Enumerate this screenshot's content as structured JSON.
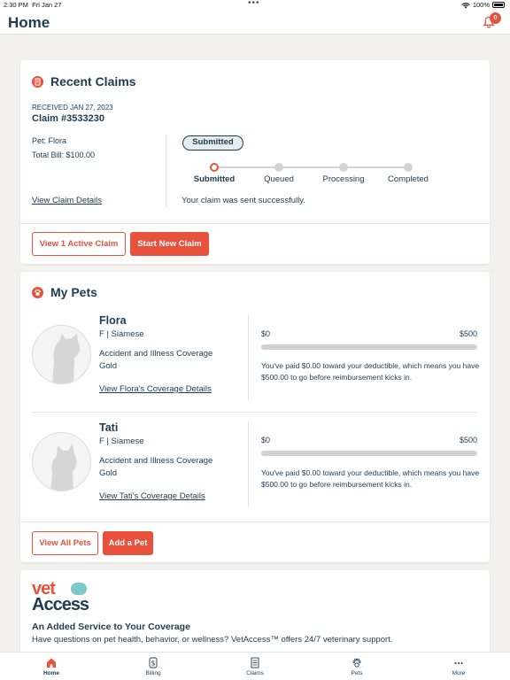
{
  "status": {
    "time": "2:30 PM",
    "date": "Fri Jan 27",
    "battery": "100%"
  },
  "header": {
    "title": "Home",
    "notification_count": "0"
  },
  "recent_claims": {
    "title": "Recent Claims",
    "received": "RECEIVED JAN 27, 2023",
    "claim_number": "Claim #3533230",
    "pet": "Pet: Flora",
    "total_bill": "Total Bill: $100.00",
    "view_details": "View Claim Details",
    "status_badge": "Submitted",
    "steps": [
      "Submitted",
      "Queued",
      "Processing",
      "Completed"
    ],
    "active_step": 0,
    "message": "Your claim was sent successfully.",
    "btn_active": "View 1 Active Claim",
    "btn_new": "Start New Claim"
  },
  "my_pets": {
    "title": "My Pets",
    "pets": [
      {
        "name": "Flora",
        "info": "F | Siamese",
        "coverage": "Accident and Illness Coverage",
        "plan": "Gold",
        "link": "View Flora's Coverage Details",
        "min": "$0",
        "max": "$500",
        "deductible_paid_fraction": 0,
        "desc": "You've paid $0.00 toward your deductible, which means you have $500.00 to go before reimbursement kicks in."
      },
      {
        "name": "Tati",
        "info": "F | Siamese",
        "coverage": "Accident and Illness Coverage",
        "plan": "Gold",
        "link": "View Tati's Coverage Details",
        "min": "$0",
        "max": "$500",
        "deductible_paid_fraction": 0,
        "desc": "You've paid $0.00 toward your deductible, which means you have $500.00 to go before reimbursement kicks in."
      }
    ],
    "btn_all": "View All Pets",
    "btn_add": "Add a Pet"
  },
  "vetaccess": {
    "logo_top": "vet",
    "logo_bottom": "Access",
    "heading": "An Added Service to Your Coverage",
    "text": "Have questions on pet health, behavior, or wellness? VetAccess™ offers 24/7 veterinary support."
  },
  "tabs": [
    {
      "label": "Home",
      "icon": "home-icon"
    },
    {
      "label": "Billing",
      "icon": "dollar-icon"
    },
    {
      "label": "Claims",
      "icon": "document-icon"
    },
    {
      "label": "Pets",
      "icon": "paw-icon"
    },
    {
      "label": "More",
      "icon": "more-icon"
    }
  ],
  "colors": {
    "accent": "#e8523c",
    "navy": "#1d3b52",
    "teal": "#7fc8c8",
    "background": "#f2f1ee"
  }
}
